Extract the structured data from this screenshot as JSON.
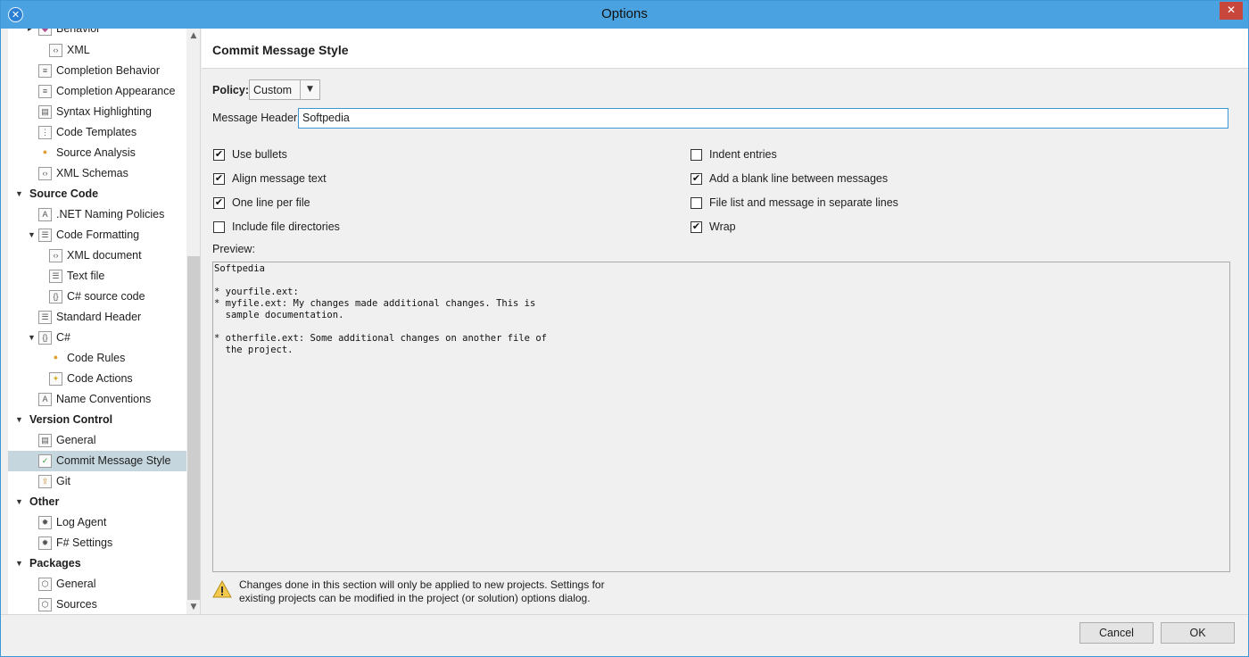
{
  "window": {
    "title": "Options",
    "close_glyph": "✕",
    "app_glyph": "✕"
  },
  "sidebar": {
    "items": [
      {
        "label": "Behavior",
        "icon": "diamond-icon"
      },
      {
        "label": "XML",
        "icon": "xml-file-icon"
      },
      {
        "label": "Completion Behavior",
        "icon": "list-icon"
      },
      {
        "label": "Completion Appearance",
        "icon": "list-icon"
      },
      {
        "label": "Syntax Highlighting",
        "icon": "palette-icon"
      },
      {
        "label": "Code Templates",
        "icon": "template-icon"
      },
      {
        "label": "Source Analysis",
        "icon": "bullet-icon"
      },
      {
        "label": "XML Schemas",
        "icon": "xml-file-icon"
      },
      {
        "label": "Source Code",
        "icon": ""
      },
      {
        "label": ".NET Naming Policies",
        "icon": "naming-icon"
      },
      {
        "label": "Code Formatting",
        "icon": "document-icon"
      },
      {
        "label": "XML document",
        "icon": "xml-file-icon"
      },
      {
        "label": "Text file",
        "icon": "text-file-icon"
      },
      {
        "label": "C# source code",
        "icon": "csharp-file-icon"
      },
      {
        "label": "Standard Header",
        "icon": "document-icon"
      },
      {
        "label": "C#",
        "icon": "csharp-file-icon"
      },
      {
        "label": "Code Rules",
        "icon": "bullet-icon"
      },
      {
        "label": "Code Actions",
        "icon": "lightbulb-icon"
      },
      {
        "label": "Name Conventions",
        "icon": "naming-icon"
      },
      {
        "label": "Version Control",
        "icon": ""
      },
      {
        "label": "General",
        "icon": "server-icon"
      },
      {
        "label": "Commit Message Style",
        "icon": "check-circle-icon"
      },
      {
        "label": "Git",
        "icon": "git-icon"
      },
      {
        "label": "Other",
        "icon": ""
      },
      {
        "label": "Log Agent",
        "icon": "gear-icon"
      },
      {
        "label": "F# Settings",
        "icon": "gear-icon"
      },
      {
        "label": "Packages",
        "icon": ""
      },
      {
        "label": "General",
        "icon": "package-icon"
      },
      {
        "label": "Sources",
        "icon": "package-icon"
      }
    ]
  },
  "main": {
    "title": "Commit Message Style",
    "policy_label": "Policy:",
    "policy_value": "Custom",
    "header_label": "Message Header:",
    "header_value": "Softpedia",
    "options_left": [
      {
        "label": "Use bullets",
        "checked": true
      },
      {
        "label": "Align message text",
        "checked": true
      },
      {
        "label": "One line per file",
        "checked": true
      },
      {
        "label": "Include file directories",
        "checked": false
      }
    ],
    "options_right": [
      {
        "label": "Indent entries",
        "checked": false
      },
      {
        "label": "Add a blank line between messages",
        "checked": true
      },
      {
        "label": "File list and message in separate lines",
        "checked": false
      },
      {
        "label": "Wrap",
        "checked": true
      }
    ],
    "preview_label": "Preview:",
    "preview_text": "Softpedia\n\n* yourfile.ext:\n* myfile.ext: My changes made additional changes. This is\n  sample documentation.\n\n* otherfile.ext: Some additional changes on another file of\n  the project.",
    "warning_text": "Changes done in this section will only be applied to new projects. Settings for existing projects can be modified in the project (or solution) options dialog."
  },
  "footer": {
    "cancel_label": "Cancel",
    "ok_label": "OK"
  },
  "colors": {
    "titlebar": "#4aa3e0",
    "selection": "#c6d6de",
    "close": "#c7473d"
  }
}
